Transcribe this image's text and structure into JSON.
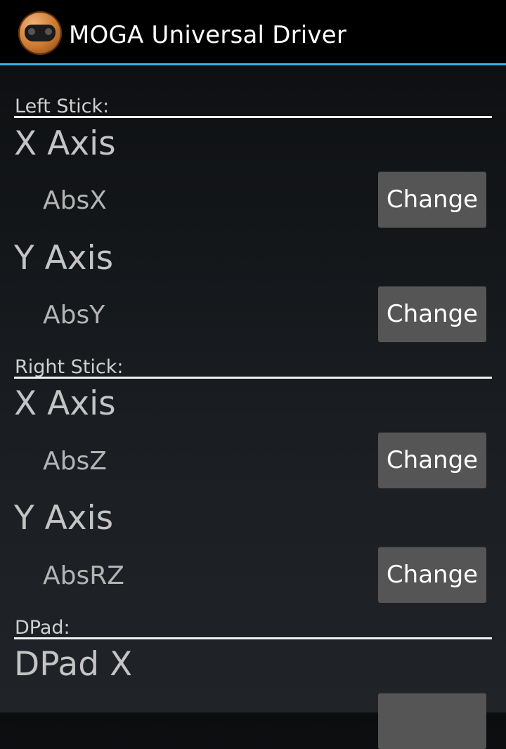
{
  "app": {
    "title": "MOGA Universal Driver",
    "icon": "gamepad-app-icon"
  },
  "sections": [
    {
      "header": "Left Stick:",
      "items": [
        {
          "title": "X Axis",
          "value": "AbsX",
          "button": "Change"
        },
        {
          "title": "Y Axis",
          "value": "AbsY",
          "button": "Change"
        }
      ]
    },
    {
      "header": "Right Stick:",
      "items": [
        {
          "title": "X Axis",
          "value": "AbsZ",
          "button": "Change"
        },
        {
          "title": "Y Axis",
          "value": "AbsRZ",
          "button": "Change"
        }
      ]
    },
    {
      "header": "DPad:",
      "items": [
        {
          "title": "DPad X",
          "value": "",
          "button": ""
        }
      ]
    }
  ],
  "colors": {
    "accent": "#33b5e5",
    "action_bar": "#000000",
    "button": "#555555"
  }
}
